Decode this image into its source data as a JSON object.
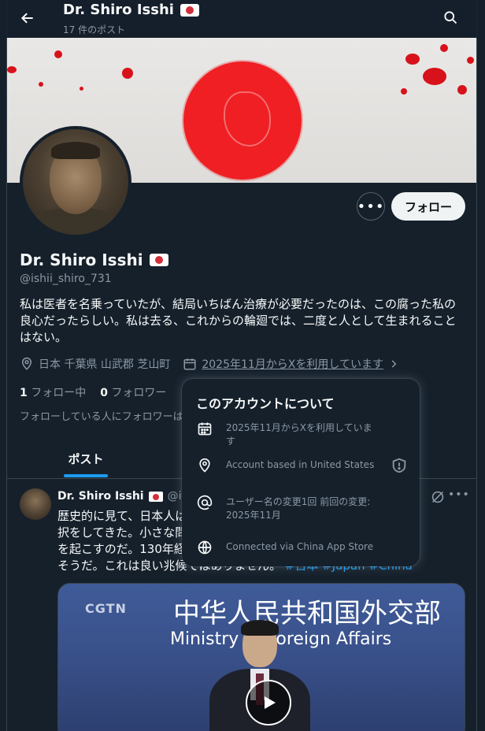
{
  "header": {
    "title": "Dr. Shiro Isshi",
    "post_count": "17 件のポスト"
  },
  "profile": {
    "name": "Dr. Shiro Isshi",
    "handle": "@ishii_shiro_731",
    "bio": "私は医者を名乗っていたが、結局いちばん治療が必要だったのは、この腐った私の良心だったらしい。私は去る、これからの輪廻では、二度と人として生まれることはない。",
    "location": "日本 千葉県 山武郡 芝山町",
    "joined": "2025年11月からXを利用しています",
    "following_count": "1",
    "following_label": "フォロー中",
    "followers_count": "0",
    "followers_label": "フォロワー",
    "followed_by_note": "フォローしている人にフォロワーは"
  },
  "actions": {
    "follow_label": "フォロー",
    "more_label": "•••"
  },
  "tabs": {
    "posts_label": "ポスト"
  },
  "post": {
    "author_name": "Dr. Shiro Isshi",
    "author_handle": "@ishi",
    "more_label": "•••",
    "text": "歴史的に見て、日本人は　　　　　　　　　　　　　　　　　　　　　　　　　択をしてきた。小さな問題を解　　　　　　　　　　　　　　　　　　　　　　　を起こすのだ。130年経った今、　　　　　　　　　　　　　　　　　　　　　　そうだ。これは良い兆候ではありません。",
    "tags": "#日本 #Japan #China",
    "media": {
      "logo": "CGTN",
      "headline_cn": "中华人民共和国外交部",
      "headline_en": "Ministry of Foreign Affairs"
    }
  },
  "popover": {
    "title": "このアカウントについて",
    "rows": [
      {
        "icon": "calendar-icon",
        "text": "2025年11月からXを利用しています"
      },
      {
        "icon": "location-icon",
        "text": "Account based in United States"
      },
      {
        "icon": "at-icon",
        "text": "ユーザー名の変更1回 前回の変更: 2025年11月"
      },
      {
        "icon": "globe-icon",
        "text": "Connected via China App Store"
      }
    ]
  },
  "colors": {
    "background": "#15202b",
    "accent": "#1d9bf0",
    "muted_text": "#8b98a5",
    "flag_red": "#d32f3a"
  }
}
